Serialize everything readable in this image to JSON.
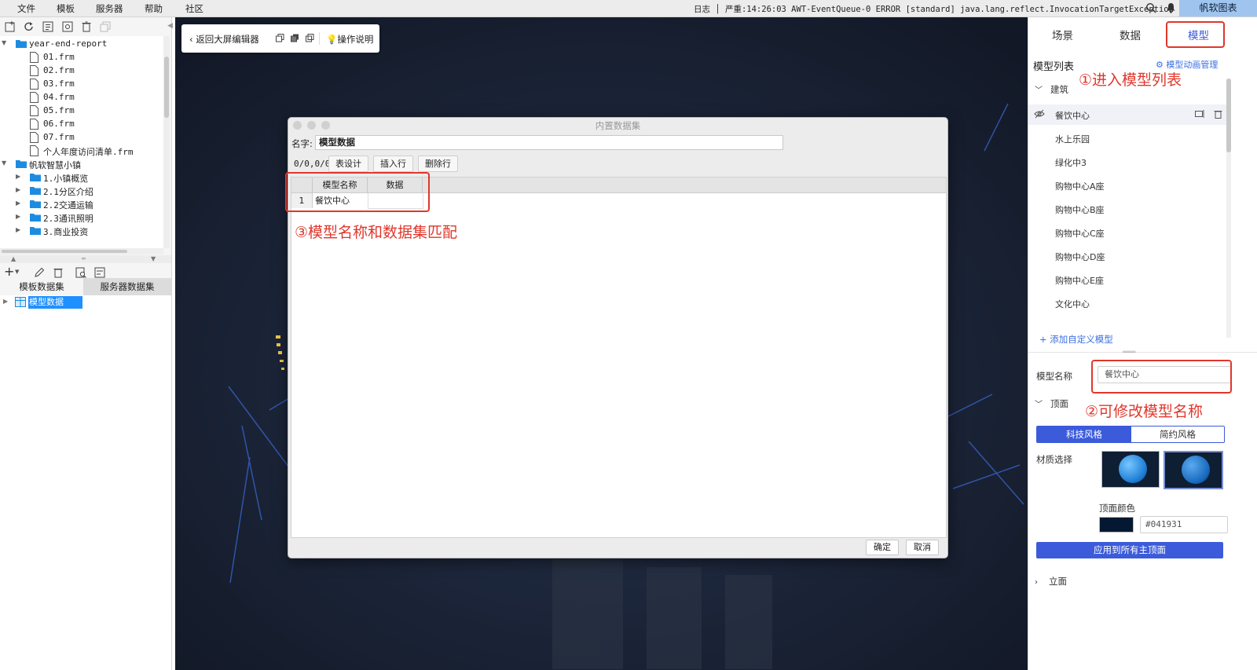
{
  "menubar": {
    "items": [
      "文件",
      "模板",
      "服务器",
      "帮助",
      "社区"
    ],
    "log_text": "日志 │ 严重:14:26:03 AWT-EventQueue-0 ERROR [standard] java.lang.reflect.InvocationTargetException",
    "brand": "帆软图表"
  },
  "tree": {
    "rows": [
      {
        "label": "year-end-report",
        "type": "folder",
        "expanded": true
      },
      {
        "label": "01.frm",
        "type": "file"
      },
      {
        "label": "02.frm",
        "type": "file"
      },
      {
        "label": "03.frm",
        "type": "file"
      },
      {
        "label": "04.frm",
        "type": "file"
      },
      {
        "label": "05.frm",
        "type": "file"
      },
      {
        "label": "06.frm",
        "type": "file"
      },
      {
        "label": "07.frm",
        "type": "file"
      },
      {
        "label": "个人年度访问清单.frm",
        "type": "file"
      },
      {
        "label": "帆软智慧小镇",
        "type": "folder",
        "expanded": true
      },
      {
        "label": "1.小镇概览",
        "type": "folder",
        "expanded": false
      },
      {
        "label": "2.1分区介绍",
        "type": "folder",
        "expanded": false
      },
      {
        "label": "2.2交通运输",
        "type": "folder",
        "expanded": false
      },
      {
        "label": "2.3通讯照明",
        "type": "folder",
        "expanded": false
      },
      {
        "label": "3.商业投资",
        "type": "folder",
        "expanded": false
      }
    ]
  },
  "dataset": {
    "tabs": [
      "模板数据集",
      "服务器数据集"
    ],
    "selected_item": "模型数据"
  },
  "canvas_toolbar": {
    "back_label": "返回大屏编辑器",
    "help_label": "操作说明"
  },
  "dialog": {
    "title": "内置数据集",
    "name_label": "名字:",
    "name_value": "模型数据",
    "rowcol": "0/0,0/0",
    "buttons": [
      "表设计",
      "插入行",
      "删除行"
    ],
    "columns": [
      "模型名称",
      "数据"
    ],
    "rows": [
      {
        "index": "1",
        "cells": [
          "餐饮中心",
          ""
        ]
      }
    ],
    "ok_label": "确定",
    "cancel_label": "取消"
  },
  "annotations": {
    "a1": "①进入模型列表",
    "a2": "②可修改模型名称",
    "a3": "③模型名称和数据集匹配"
  },
  "rightpanel": {
    "tabs": [
      "场景",
      "数据",
      "模型"
    ],
    "active_tab": "模型",
    "model_list_title": "模型列表",
    "anim_manage": "模型动画管理",
    "category": "建筑",
    "models": [
      "餐饮中心",
      "水上乐园",
      "绿化中3",
      "购物中心A座",
      "购物中心B座",
      "购物中心C座",
      "购物中心D座",
      "购物中心E座",
      "文化中心"
    ],
    "selected_model": "餐饮中心",
    "add_custom": "+ 添加自定义模型",
    "model_name_label": "模型名称",
    "model_name_value": "餐饮中心",
    "section_top": "顶面",
    "style_tech": "科技风格",
    "style_simple": "简约风格",
    "material_label": "材质选择",
    "top_color_label": "顶面颜色",
    "top_color_hex": "#041931",
    "apply_label": "应用到所有主顶面",
    "section_facade": "立面"
  },
  "colors": {
    "accent": "#3b5bdb",
    "annotation_red": "#e0372b",
    "canvas_bg": "#1a2234",
    "top_color": "#041931"
  }
}
